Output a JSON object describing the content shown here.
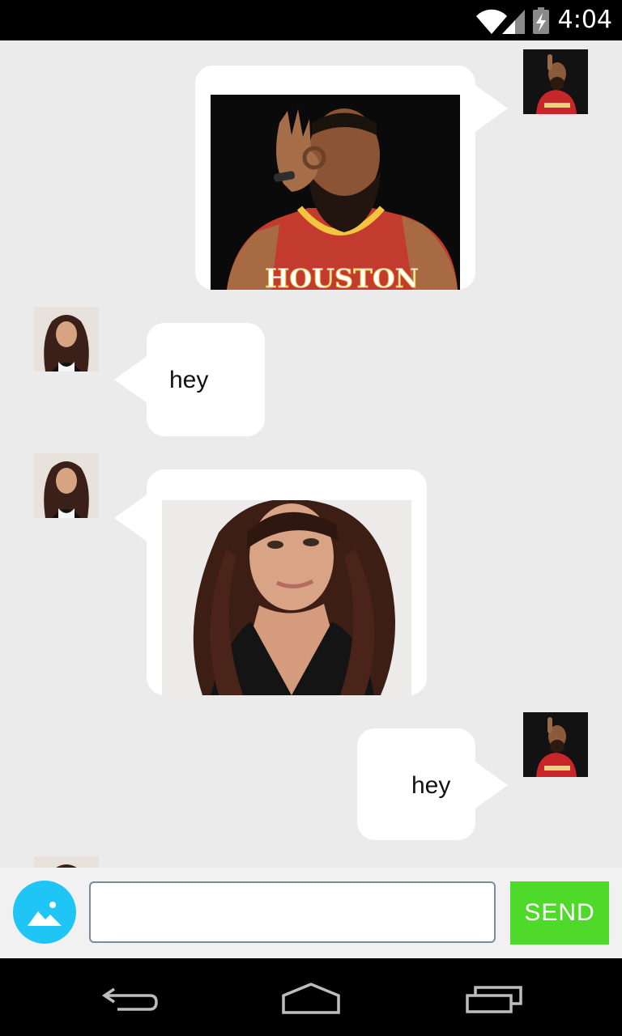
{
  "status_bar": {
    "time": "4:04",
    "icons": [
      "wifi-icon",
      "cell-signal-icon",
      "battery-charging-icon"
    ]
  },
  "messages": [
    {
      "sender": "self",
      "type": "image",
      "image": "houston-player-photo",
      "jersey_text": "HOUSTON",
      "avatar": "self-avatar"
    },
    {
      "sender": "other",
      "type": "text",
      "text": "hey",
      "avatar": "contact-avatar"
    },
    {
      "sender": "other",
      "type": "image",
      "image": "contact-photo",
      "avatar": "contact-avatar"
    },
    {
      "sender": "self",
      "type": "text",
      "text": "hey",
      "avatar": "self-avatar"
    }
  ],
  "input_bar": {
    "gallery_icon": "image-icon",
    "message_value": "",
    "send_label": "SEND"
  },
  "nav_bar": {
    "icons": [
      "back-icon",
      "home-icon",
      "recents-icon"
    ]
  },
  "colors": {
    "chat_background": "#ebebeb",
    "bubble": "#ffffff",
    "gallery_button": "#1ec5f5",
    "send_button": "#4fd92a"
  }
}
